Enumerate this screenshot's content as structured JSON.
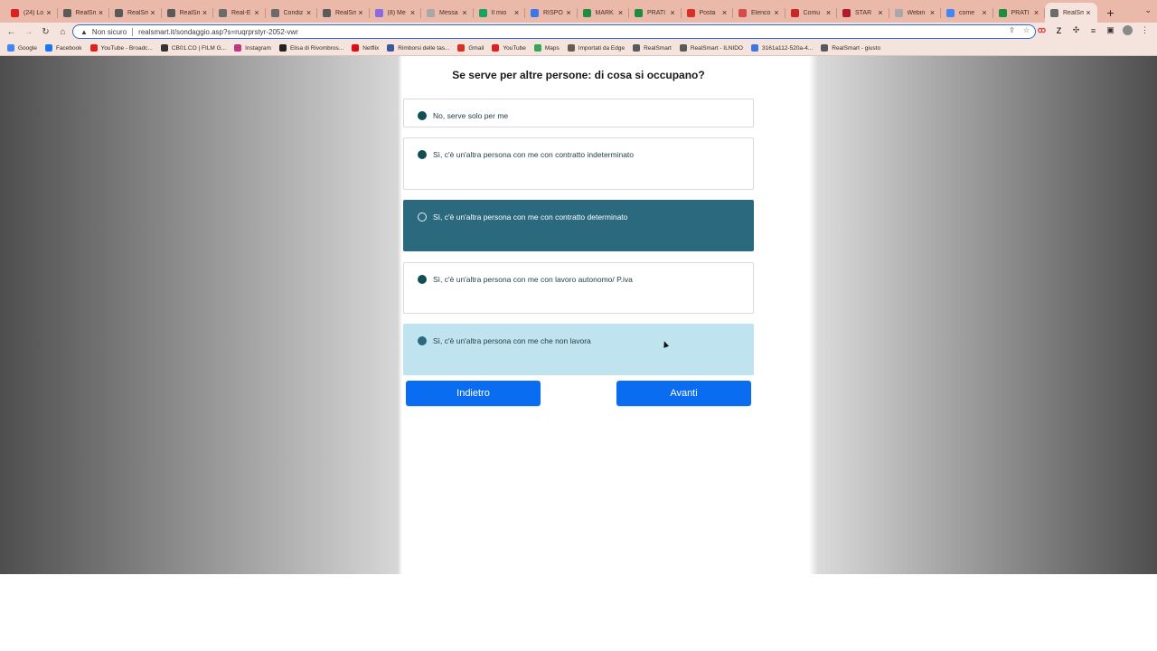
{
  "browser": {
    "tabs": [
      {
        "title": "(24) Lo",
        "icon": "youtube-icon",
        "color": "#e02020",
        "active": false
      },
      {
        "title": "RealSm",
        "icon": "realsmart-icon",
        "color": "#5a5a5a",
        "active": false
      },
      {
        "title": "RealSm",
        "icon": "realsmart-icon",
        "color": "#5a5a5a",
        "active": false
      },
      {
        "title": "RealSm",
        "icon": "realsmart-icon",
        "color": "#5a5a5a",
        "active": false
      },
      {
        "title": "Real-E",
        "icon": "globe-icon",
        "color": "#6b6b6b",
        "active": false
      },
      {
        "title": "Condiz",
        "icon": "globe-icon",
        "color": "#6b6b6b",
        "active": false
      },
      {
        "title": "RealSm",
        "icon": "realsmart-icon",
        "color": "#5a5a5a",
        "active": false
      },
      {
        "title": "(8) Me",
        "icon": "messenger-icon",
        "color": "#8a6adf",
        "active": false
      },
      {
        "title": "Messa",
        "icon": "cloud-icon",
        "color": "#a8a8a8",
        "active": false
      },
      {
        "title": "Il mio",
        "icon": "drive-icon",
        "color": "#1aa260",
        "active": false
      },
      {
        "title": "RISPO",
        "icon": "docs-icon",
        "color": "#3b78e7",
        "active": false
      },
      {
        "title": "MARK",
        "icon": "sheets-icon",
        "color": "#1e8e3e",
        "active": false
      },
      {
        "title": "PRATI",
        "icon": "sheets-icon",
        "color": "#1e8e3e",
        "active": false
      },
      {
        "title": "Posta",
        "icon": "gmail-icon",
        "color": "#d93025",
        "active": false
      },
      {
        "title": "Elenco",
        "icon": "globe-icon",
        "color": "#d34b4b",
        "active": false
      },
      {
        "title": "Comu",
        "icon": "angular-icon",
        "color": "#c62828",
        "active": false
      },
      {
        "title": "STAR",
        "icon": "star-app-icon",
        "color": "#b01c2e",
        "active": false
      },
      {
        "title": "Webin",
        "icon": "cloud-icon",
        "color": "#a8a8a8",
        "active": false
      },
      {
        "title": "come",
        "icon": "google-icon",
        "color": "#4285f4",
        "active": false
      },
      {
        "title": "PRATI",
        "icon": "sheets-icon",
        "color": "#1e8e3e",
        "active": false
      },
      {
        "title": "RealSm",
        "icon": "globe-icon",
        "color": "#6b6b6b",
        "active": true
      }
    ],
    "new_tab_symbol": "+",
    "address": {
      "security_label": "Non sicuro",
      "url": "realsmart.it/sondaggio.asp?s=ruqrprstyr-2052-vwr"
    },
    "bookmarks": [
      {
        "label": "Google",
        "icon": "google-icon",
        "color": "#4285f4"
      },
      {
        "label": "Facebook",
        "icon": "facebook-icon",
        "color": "#1877f2"
      },
      {
        "label": "YouTube - Broadc...",
        "icon": "youtube-icon",
        "color": "#e02020"
      },
      {
        "label": "CB01.CO | FILM G...",
        "icon": "film-icon",
        "color": "#333333"
      },
      {
        "label": "Instagram",
        "icon": "instagram-icon",
        "color": "#c13584"
      },
      {
        "label": "Elisa di Rivombros...",
        "icon": "bookmark-icon",
        "color": "#222222"
      },
      {
        "label": "Netflix",
        "icon": "netflix-icon",
        "color": "#e50914"
      },
      {
        "label": "Rimborsi delle tas...",
        "icon": "document-icon",
        "color": "#3b5998"
      },
      {
        "label": "Gmail",
        "icon": "gmail-icon",
        "color": "#d93025"
      },
      {
        "label": "YouTube",
        "icon": "youtube-icon",
        "color": "#e02020"
      },
      {
        "label": "Maps",
        "icon": "maps-icon",
        "color": "#34a853"
      },
      {
        "label": "Importati da Edge",
        "icon": "folder-icon",
        "color": "#6b5a52"
      },
      {
        "label": "RealSmart",
        "icon": "realsmart-icon",
        "color": "#5a5a5a"
      },
      {
        "label": "RealSmart - ILNIDO",
        "icon": "realsmart-icon",
        "color": "#5a5a5a"
      },
      {
        "label": "3161a112-520a-4...",
        "icon": "link-icon",
        "color": "#3b78e7"
      },
      {
        "label": "RealSmart - giusto",
        "icon": "realsmart-icon",
        "color": "#5a5a5a"
      }
    ]
  },
  "survey": {
    "question": "Se serve per altre persone: di cosa si occupano?",
    "options": [
      {
        "label": "No, serve solo per me",
        "state": "default"
      },
      {
        "label": "Sì, c'è un'altra persona con me con contratto indeterminato",
        "state": "default"
      },
      {
        "label": "Sì, c'è un'altra persona con me con contratto determinato",
        "state": "selected"
      },
      {
        "label": "Sì, c'è un'altra persona con me con lavoro autonomo/ P.iva",
        "state": "default"
      },
      {
        "label": "Sì, c'è un'altra persona con me che non lavora",
        "state": "hovered"
      }
    ],
    "back_label": "Indietro",
    "next_label": "Avanti"
  },
  "colors": {
    "accent_button": "#0a6cf1",
    "selected_option": "#2b6a7e",
    "hovered_option": "#bfe3ef",
    "radio_fill": "#114f56",
    "browser_frame": "#eab9a9"
  }
}
